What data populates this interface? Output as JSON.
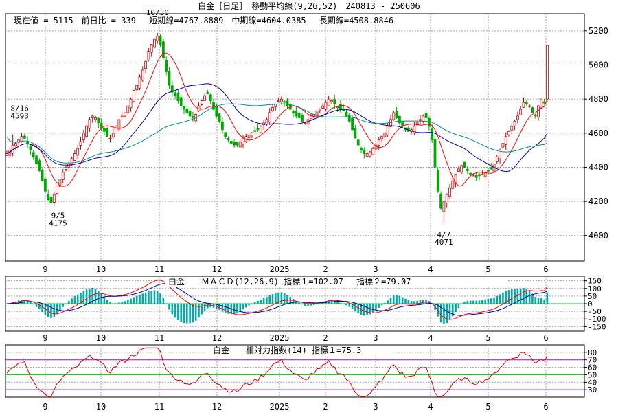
{
  "header": {
    "title": "白金［日足］　移動平均線(9,26,52)　240813 - 250606",
    "info": "現在値 = 5115　前日比 = 339　 短期線=4767.8889　中期線=4604.0385　 長期線=4508.8846"
  },
  "panels": {
    "macd": {
      "title": "白金　　ＭＡＣＤ(12,26,9) 指標１=102.07　 指標２=79.07"
    },
    "rsi": {
      "title": "白金　　相対力指数(14) 指標１=75.3"
    }
  },
  "colors": {
    "candle_up": "#cc0000",
    "candle_down": "#00aa00",
    "ma_short": "#ff0000",
    "ma_mid": "#0000aa",
    "ma_long": "#008b8b",
    "macd_hist": "#00aaaa",
    "rsi_line": "#cc0000",
    "rsi_70_30": "#cc00cc",
    "rsi_50": "#00cc00",
    "grid": "#a0a0a0"
  },
  "chart_data": [
    {
      "type": "candlestick",
      "panel": "price",
      "ylim": [
        3850,
        5300
      ],
      "y_ticks": [
        4000,
        4200,
        4400,
        4600,
        4800,
        5000,
        5200
      ],
      "x_tick_labels": [
        "9",
        "10",
        "11",
        "12",
        "2025",
        "2",
        "3",
        "4",
        "5",
        "6"
      ],
      "grid": true,
      "annotations": [
        {
          "label": "8/16",
          "value": "4593"
        },
        {
          "label": "9/5",
          "value": "4175"
        },
        {
          "label": "10/30",
          "value": "5188"
        },
        {
          "label": "4/7",
          "value": "4071"
        }
      ],
      "series": [
        {
          "key": "close",
          "values": [
            4480,
            4500,
            4530,
            4540,
            4560,
            4580,
            4570,
            4540,
            4500,
            4460,
            4420,
            4380,
            4320,
            4260,
            4210,
            4190,
            4240,
            4290,
            4330,
            4370,
            4400,
            4420,
            4450,
            4480,
            4510,
            4550,
            4600,
            4640,
            4680,
            4700,
            4690,
            4660,
            4630,
            4610,
            4580,
            4570,
            4600,
            4640,
            4680,
            4700,
            4720,
            4760,
            4800,
            4850,
            4880,
            4930,
            4970,
            5020,
            5080,
            5120,
            5150,
            5170,
            5120,
            5040,
            4960,
            4880,
            4840,
            4820,
            4790,
            4760,
            4740,
            4720,
            4700,
            4690,
            4710,
            4760,
            4790,
            4820,
            4830,
            4790,
            4740,
            4700,
            4670,
            4620,
            4580,
            4560,
            4540,
            4530,
            4530,
            4550,
            4570,
            4580,
            4590,
            4600,
            4610,
            4620,
            4640,
            4660,
            4680,
            4720,
            4750,
            4770,
            4790,
            4800,
            4780,
            4760,
            4740,
            4720,
            4700,
            4690,
            4670,
            4660,
            4680,
            4700,
            4710,
            4730,
            4740,
            4760,
            4780,
            4800,
            4790,
            4770,
            4750,
            4740,
            4730,
            4700,
            4670,
            4620,
            4570,
            4530,
            4500,
            4480,
            4480,
            4490,
            4510,
            4530,
            4560,
            4580,
            4600,
            4640,
            4680,
            4720,
            4690,
            4660,
            4640,
            4620,
            4610,
            4620,
            4640,
            4660,
            4680,
            4700,
            4690,
            4640,
            4560,
            4400,
            4260,
            4160,
            4200,
            4240,
            4280,
            4320,
            4360,
            4390,
            4410,
            4400,
            4380,
            4360,
            4350,
            4340,
            4350,
            4360,
            4370,
            4380,
            4390,
            4420,
            4460,
            4500,
            4540,
            4580,
            4610,
            4640,
            4670,
            4700,
            4740,
            4780,
            4770,
            4760,
            4720,
            4700,
            4760,
            4800,
            4776,
            5115
          ]
        },
        {
          "key": "ma_short",
          "name": "短期線",
          "last": 4767.8889
        },
        {
          "key": "ma_mid",
          "name": "中期線",
          "last": 4604.0385
        },
        {
          "key": "ma_long",
          "name": "長期線",
          "last": 4508.8846
        }
      ]
    },
    {
      "type": "line",
      "panel": "macd",
      "ylim": [
        -180,
        180
      ],
      "y_ticks": [
        -150,
        -100,
        -50,
        0,
        50,
        100,
        150
      ],
      "x_tick_labels": [
        "9",
        "10",
        "11",
        "12",
        "2025",
        "2",
        "3",
        "4",
        "5",
        "6"
      ],
      "grid": true,
      "series": [
        {
          "name": "指標１",
          "last": 102.07
        },
        {
          "name": "指標２",
          "last": 79.07
        }
      ]
    },
    {
      "type": "line",
      "panel": "rsi",
      "ylim": [
        20,
        90
      ],
      "y_ticks": [
        30,
        40,
        50,
        60,
        70,
        80
      ],
      "x_tick_labels": [
        "9",
        "10",
        "11",
        "12",
        "2025",
        "2",
        "3",
        "4",
        "5",
        "6"
      ],
      "grid": true,
      "series": [
        {
          "name": "指標１",
          "last": 75.3
        }
      ]
    }
  ]
}
